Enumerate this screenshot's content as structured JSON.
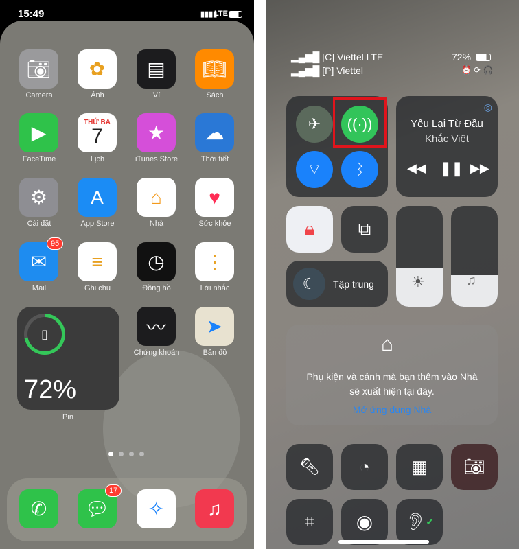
{
  "home": {
    "time": "15:49",
    "network": "LTE",
    "apps": [
      {
        "label": "Camera",
        "icon": "camera-icon",
        "color": "#9a9a9c"
      },
      {
        "label": "Ảnh",
        "icon": "photos-icon",
        "color": "#ffffff"
      },
      {
        "label": "Ví",
        "icon": "wallet-icon",
        "color": "#1c1c1e"
      },
      {
        "label": "Sách",
        "icon": "book-icon",
        "color": "#ff8a00"
      },
      {
        "label": "FaceTime",
        "icon": "video-icon",
        "color": "#2fc24a"
      },
      {
        "label": "Lịch",
        "icon": "calendar-icon",
        "color": "#ffffff"
      },
      {
        "label": "iTunes Store",
        "icon": "star-icon",
        "color": "#d54fd9"
      },
      {
        "label": "Thời tiết",
        "icon": "weather-icon",
        "color": "#2a78d6"
      },
      {
        "label": "Cài đặt",
        "icon": "gear-icon",
        "color": "#8e8e93"
      },
      {
        "label": "App Store",
        "icon": "appstore-icon",
        "color": "#1b8cf5"
      },
      {
        "label": "Nhà",
        "icon": "home-icon",
        "color": "#ffffff"
      },
      {
        "label": "Sức khỏe",
        "icon": "heart-icon",
        "color": "#ffffff"
      },
      {
        "label": "Mail",
        "icon": "mail-icon",
        "color": "#1e8cf0",
        "badge": "95"
      },
      {
        "label": "Ghi chú",
        "icon": "notes-icon",
        "color": "#ffffff"
      },
      {
        "label": "Đồng hồ",
        "icon": "clock-icon",
        "color": "#111111"
      },
      {
        "label": "Lời nhắc",
        "icon": "reminders-icon",
        "color": "#ffffff"
      }
    ],
    "calendar": {
      "day": "THỨ BA",
      "date": "7"
    },
    "battery_widget": {
      "percent": "72%",
      "level": 72,
      "label": "Pin"
    },
    "row5": [
      {
        "label": "Chứng khoán",
        "icon": "stocks-icon",
        "color": "#1c1c1e"
      },
      {
        "label": "Bản đồ",
        "icon": "maps-icon",
        "color": "#e8e2d0"
      }
    ],
    "dock": [
      {
        "name": "phone",
        "icon": "phone-icon",
        "color": "#2fc24a"
      },
      {
        "name": "messages",
        "icon": "messages-icon",
        "color": "#2fc24a",
        "badge": "17"
      },
      {
        "name": "safari",
        "icon": "safari-icon",
        "color": "#ffffff"
      },
      {
        "name": "music",
        "icon": "music-icon",
        "color": "#f2394f"
      }
    ]
  },
  "cc": {
    "carrier1": "Viettel LTE",
    "sim1": "C",
    "carrier2": "Viettel",
    "sim2": "P",
    "battery": "72%",
    "music": {
      "title": "Yêu Lại Từ Đầu",
      "artist": "Khắc Việt"
    },
    "focus": "Tập trung",
    "brightness_level": 0.38,
    "volume_level": 0.31,
    "home_text1": "Phụ kiện và cảnh mà bạn thêm vào Nhà",
    "home_text2": "sẽ xuất hiện tại đây.",
    "home_link": "Mở ứng dụng Nhà",
    "highlight_color": "#e0141c",
    "cellular_color": "#32c45a",
    "accent_blue": "#1a82fb"
  }
}
